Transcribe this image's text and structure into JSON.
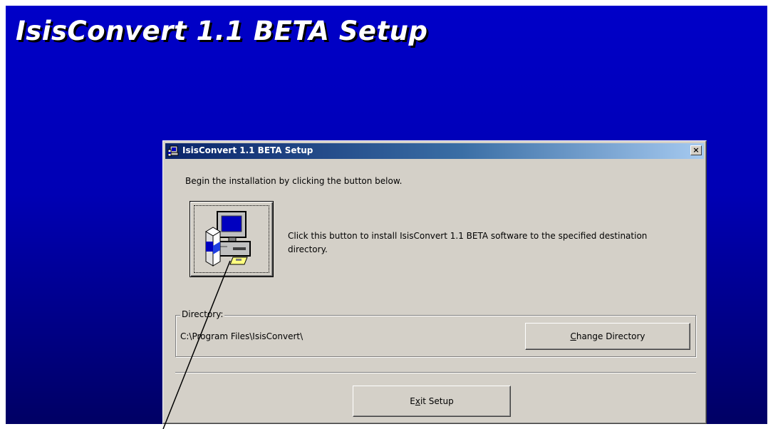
{
  "setup_screen": {
    "title": "IsisConvert 1.1 BETA Setup",
    "background_top": "#0000c8",
    "background_bottom": "#000064"
  },
  "dialog": {
    "title": "IsisConvert 1.1 BETA Setup",
    "close_label": "×",
    "instruction": "Begin the installation by clicking the button below.",
    "install_button_icon": "computer-setup-icon",
    "install_description": "Click this button to install IsisConvert 1.1 BETA software to the specified destination directory.",
    "directory_group": {
      "legend": "Directory:",
      "path": "C:\\Program Files\\IsisConvert\\",
      "change_button_prefix": "",
      "change_button_hotkey": "C",
      "change_button_rest": "hange Directory"
    },
    "exit_button_prefix": "E",
    "exit_button_hotkey": "x",
    "exit_button_rest": "it Setup"
  },
  "colors": {
    "dialog_face": "#d4d0c8",
    "titlebar_start": "#0a246a",
    "titlebar_end": "#a6caf0"
  }
}
